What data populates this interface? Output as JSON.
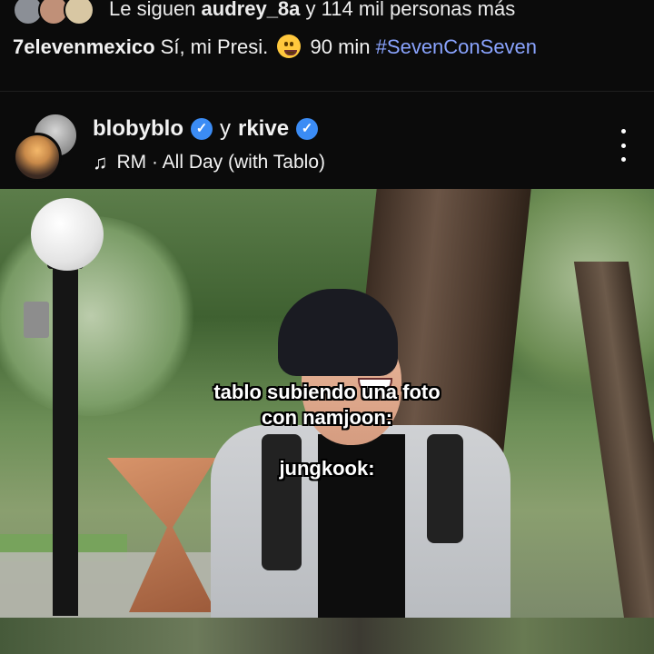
{
  "followers_line": {
    "prefix": "Le siguen",
    "user": "audrey_8a",
    "suffix": "y 114 mil personas más"
  },
  "caption": {
    "user": "7elevenmexico",
    "text": "Sí, mi Presi.",
    "emoji": "slightly-smiling-face-emoji",
    "duration": "90 min",
    "hashtag": "#SevenConSeven"
  },
  "post": {
    "author1": "blobyblo",
    "connector": "y",
    "author2": "rkive",
    "music_icon": "music-note-icon",
    "music": "RM · All Day (with Tablo)",
    "menu_icon": "more-vertical-icon"
  },
  "overlay": {
    "line1": "tablo subiendo una foto",
    "line2": "con namjoon:",
    "line3": "jungkook:"
  },
  "colors": {
    "background": "#0b0b0b",
    "hashtag": "#8aa4ff",
    "verified": "#3b8cf5"
  }
}
